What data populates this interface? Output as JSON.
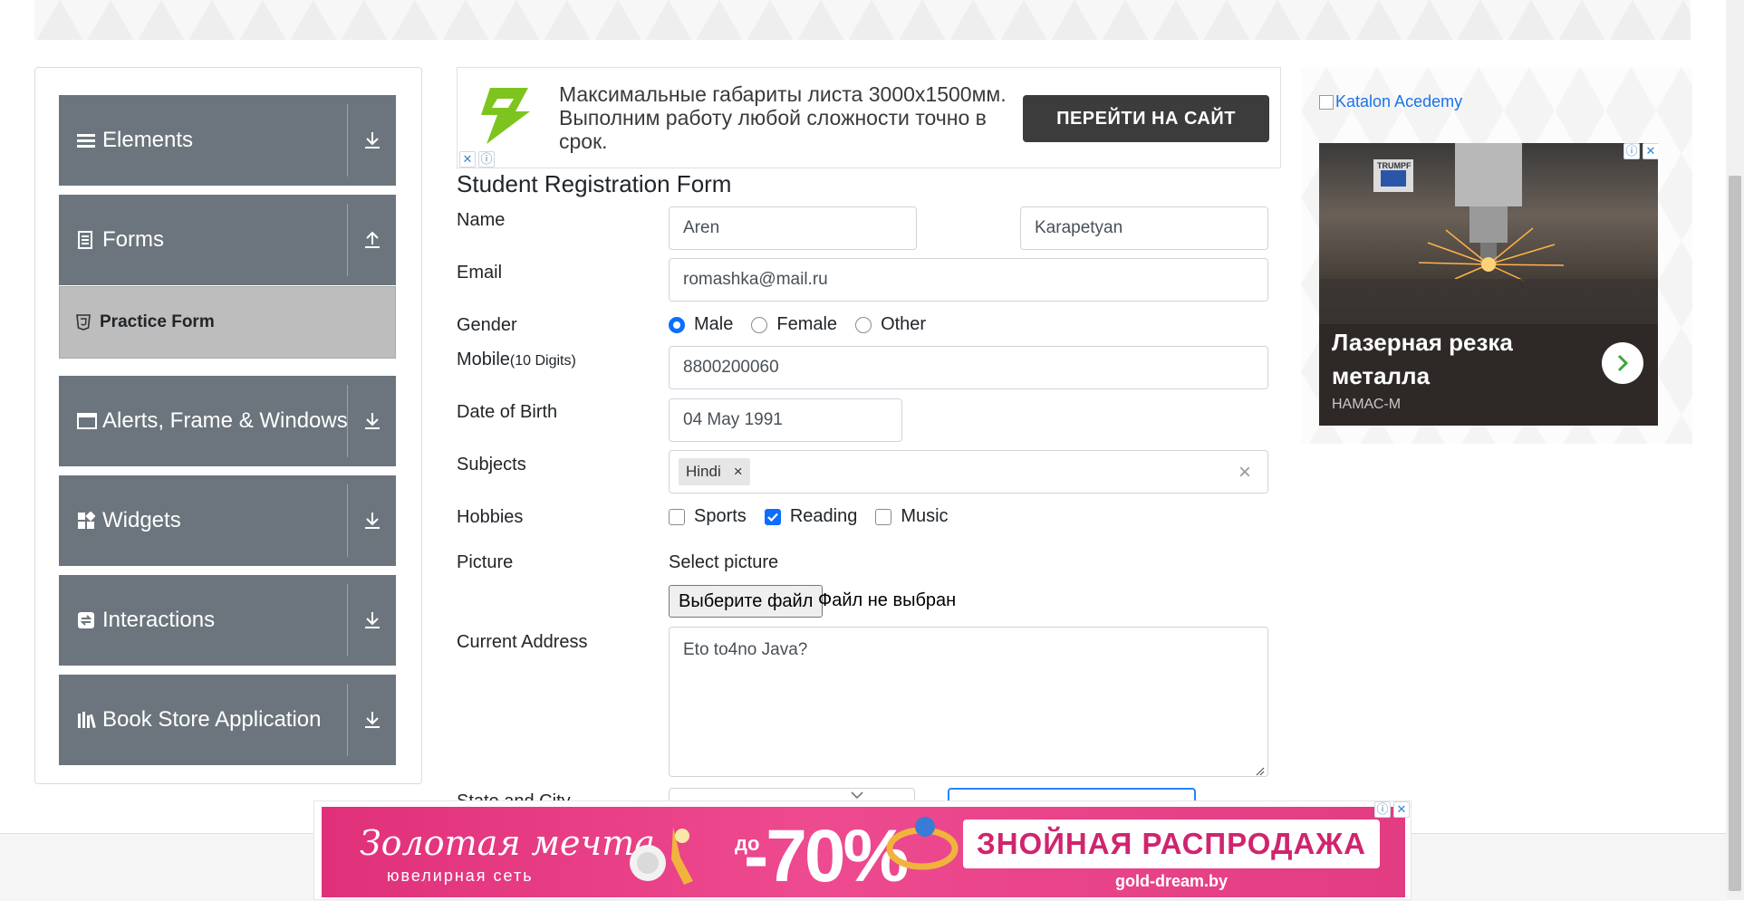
{
  "sidebar": {
    "groups": [
      {
        "label": "Elements",
        "icon": "hamburger-icon",
        "state": "collapsed"
      },
      {
        "label": "Forms",
        "icon": "form-icon",
        "state": "expanded"
      },
      {
        "label": "Alerts, Frame & Windows",
        "icon": "window-icon",
        "state": "collapsed"
      },
      {
        "label": "Widgets",
        "icon": "widgets-icon",
        "state": "collapsed"
      },
      {
        "label": "Interactions",
        "icon": "interactions-icon",
        "state": "collapsed"
      },
      {
        "label": "Book Store Application",
        "icon": "books-icon",
        "state": "collapsed"
      }
    ],
    "active_item": {
      "label": "Practice Form",
      "icon": "html5-icon"
    }
  },
  "top_ad": {
    "text": "Максимальные габариты листа 3000x1500мм. Выполним работу любой сложности точно в срок.",
    "button": "ПЕРЕЙТИ НА САЙТ",
    "logo_color": "#7dc41f"
  },
  "form": {
    "title": "Student Registration Form",
    "name_label": "Name",
    "first_name": "Aren",
    "last_name": "Karapetyan",
    "email_label": "Email",
    "email": "romashka@mail.ru",
    "gender_label": "Gender",
    "gender_options": [
      "Male",
      "Female",
      "Other"
    ],
    "gender_selected": "Male",
    "mobile_label": "Mobile",
    "mobile_hint": "(10 Digits)",
    "mobile": "8800200060",
    "dob_label": "Date of Birth",
    "dob": "04 May 1991",
    "subjects_label": "Subjects",
    "subjects": [
      "Hindi"
    ],
    "subject_remove": "×",
    "subjects_clear": "×",
    "hobbies_label": "Hobbies",
    "hobbies": [
      {
        "label": "Sports",
        "checked": false
      },
      {
        "label": "Reading",
        "checked": true
      },
      {
        "label": "Music",
        "checked": false
      }
    ],
    "picture_label": "Picture",
    "select_picture": "Select picture",
    "file_button": "Выберите файл",
    "file_status": "Файл не выбран",
    "address_label": "Current Address",
    "address": "Eto to4no Java?",
    "state_city_label": "State and City"
  },
  "right_ad": {
    "link_text": "Katalon Acedemy",
    "title": "Лазерная резка металла",
    "subtitle": "НАМАС-М",
    "photo_brand": "TRUMPF"
  },
  "bottom_ad": {
    "brand": "Золотая мечта",
    "brand_sub": "ювелирная сеть",
    "discount_prefix": "до",
    "discount": "-70%",
    "promo": "ЗНОЙНАЯ РАСПРОДАЖА",
    "site": "gold-dream.by"
  },
  "colors": {
    "sidebar_group": "#6c757d",
    "active_item": "#bdbdbd",
    "accent": "#0d6efd",
    "ad_button": "#3c3c3c",
    "bottom_ad": "#e0307a"
  }
}
